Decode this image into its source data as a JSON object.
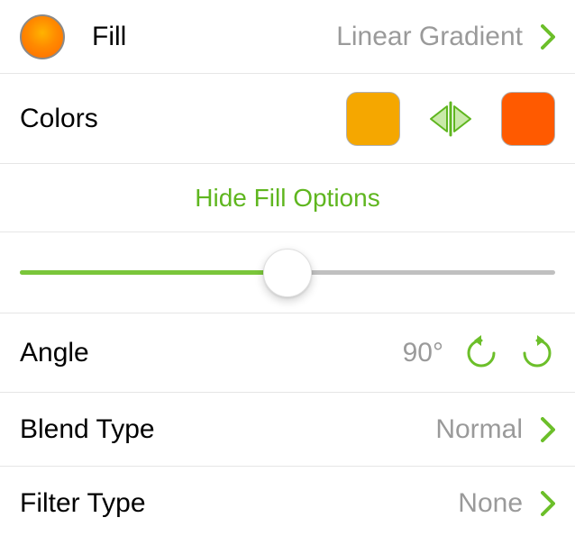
{
  "accent": "#5fb61f",
  "fill": {
    "label": "Fill",
    "type_value": "Linear Gradient",
    "swatch_gradient": "radial-gradient(circle at 50% 40%, #ffb300 0%, #ff8a00 45%, #ff6a00 100%)"
  },
  "colors": {
    "label": "Colors",
    "start_color": "#f5a700",
    "end_color": "#ff5a00"
  },
  "hide_label": "Hide Fill Options",
  "angle": {
    "label": "Angle",
    "value": "90°",
    "slider_percent": 50
  },
  "blend": {
    "label": "Blend Type",
    "value": "Normal"
  },
  "filter": {
    "label": "Filter Type",
    "value": "None"
  }
}
